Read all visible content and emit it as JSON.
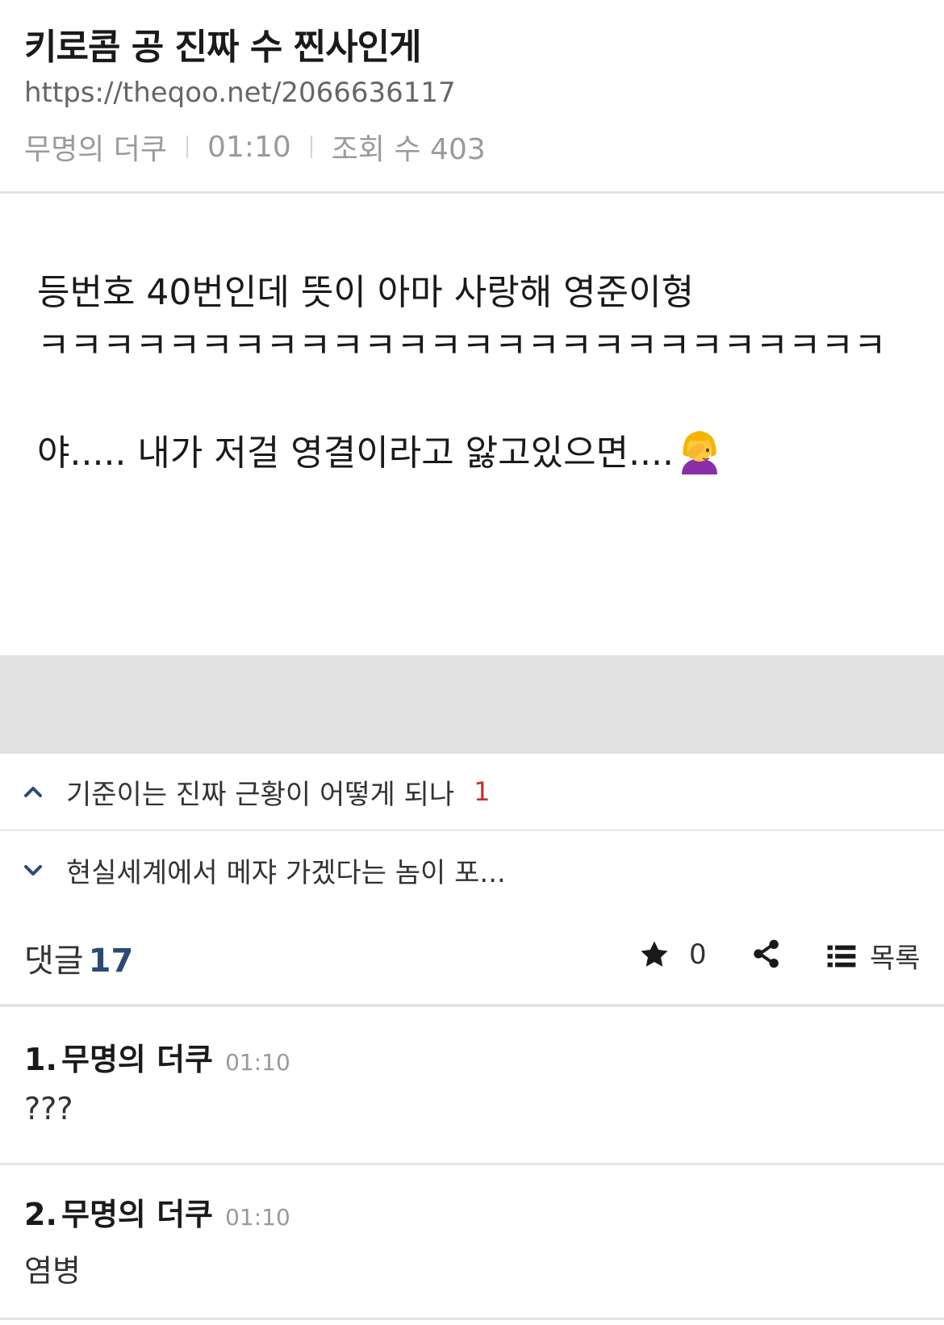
{
  "post": {
    "title": "키로콤 공 진짜 수 찐사인게",
    "url": "https://theqoo.net/2066636117",
    "author": "무명의 더쿠",
    "time": "01:10",
    "views": "조회 수 403",
    "body": {
      "line1": "등번호 40번인데 뜻이 아마 사랑해 영준이형",
      "line2": "ㅋㅋㅋㅋㅋㅋㅋㅋㅋㅋㅋㅋㅋㅋㅋㅋㅋㅋㅋㅋㅋㅋㅋㅋㅋㅋ",
      "line3": "야..... 내가 저걸 영결이라고 앓고있으면....",
      "emoji": "facepalm-woman-emoji"
    }
  },
  "nav": {
    "prev": {
      "title": "기준이는 진짜 근황이 어떻게 되나",
      "count": "1",
      "icon": "chevron-up-icon"
    },
    "next": {
      "title": "현실세계에서 메쟈 가겠다는 놈이 포...",
      "icon": "chevron-down-icon"
    }
  },
  "actions": {
    "comments_label": "댓글",
    "comments_count": "17",
    "star_count": "0",
    "list_label": "목록",
    "icons": [
      "star-icon",
      "share-icon",
      "list-icon"
    ]
  },
  "comments": [
    {
      "num": "1.",
      "author": "무명의 더쿠",
      "time": "01:10",
      "text": "???"
    },
    {
      "num": "2.",
      "author": "무명의 더쿠",
      "time": "01:10",
      "text": "염병"
    }
  ],
  "colors": {
    "accent_blue": "#2b4a77",
    "count_red": "#c4302b",
    "band_grey": "#e2e2e2"
  }
}
